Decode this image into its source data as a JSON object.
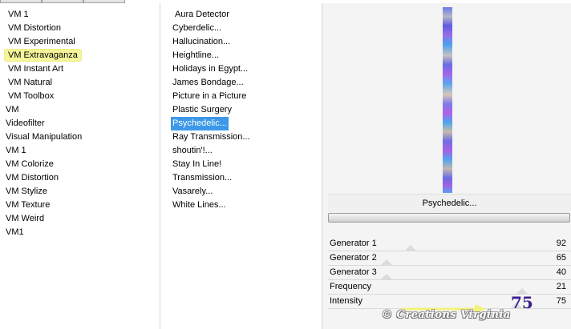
{
  "categories": [
    "VM 1",
    "VM Distortion",
    "VM Experimental",
    "VM Extravaganza",
    "VM Instant Art",
    "VM Natural",
    "VM Toolbox",
    "VM",
    "Videofilter",
    "Visual Manipulation",
    "VM 1",
    "VM Colorize",
    "VM Distortion",
    "VM Stylize",
    "VM Texture",
    "VM Weird",
    "VM1"
  ],
  "selected_category": "VM Extravaganza",
  "filters": [
    "Aura Detector",
    "Cyberdelic...",
    "Hallucination...",
    "Heightline...",
    "Holidays in Egypt...",
    "James Bondage...",
    "Picture in a Picture",
    "Plastic Surgery",
    "Psychedelic...",
    "Ray Transmission...",
    "shoutin'!...",
    "Stay In Line!",
    "Transmission...",
    "Vasarely...",
    "White Lines..."
  ],
  "selected_filter": "Psychedelic...",
  "preview_name": "Psychedelic...",
  "progress": 1.0,
  "params": [
    {
      "label": "Generator 1",
      "value": "92"
    },
    {
      "label": "Generator 2",
      "value": "65"
    },
    {
      "label": "Generator 3",
      "value": "40"
    },
    {
      "label": "Frequency",
      "value": "21"
    },
    {
      "label": "Intensity",
      "value": "75"
    }
  ],
  "annotation_value": "75",
  "watermark": "© Creations Virginia",
  "colors": {
    "selected_category_bg": "#f5f59a",
    "selected_filter_bg": "#3c98e8",
    "annotation": "#3a1c8c",
    "arrow": "#f2f27a"
  }
}
